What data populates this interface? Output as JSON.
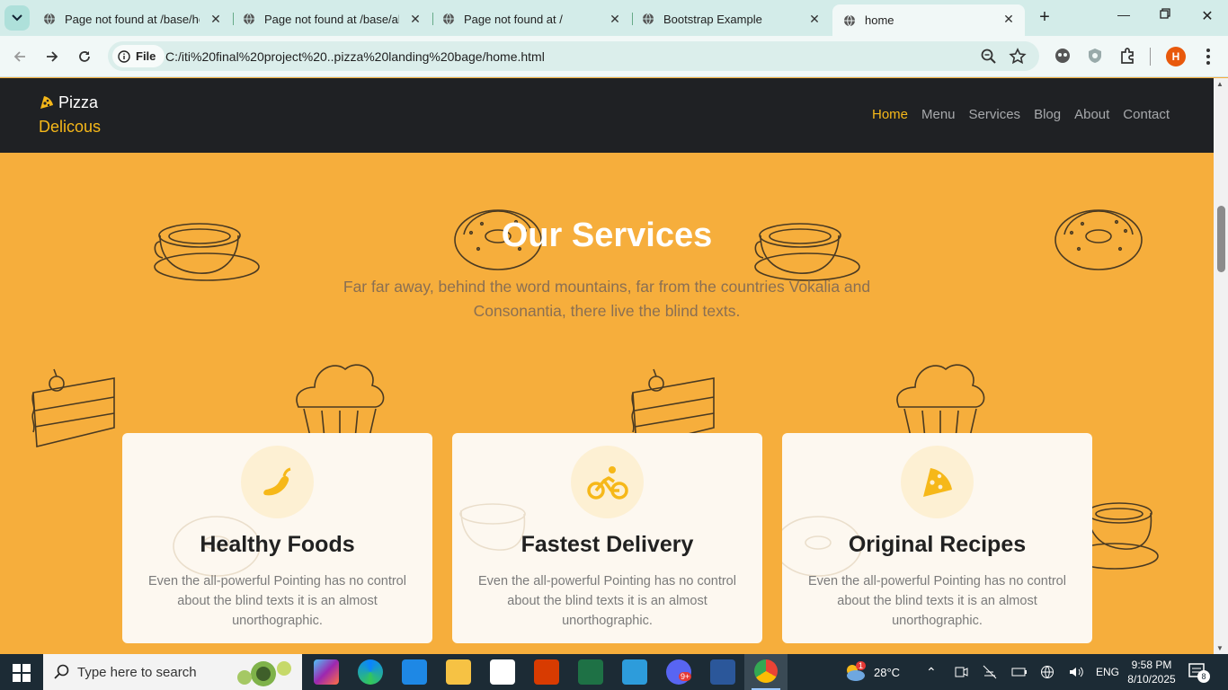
{
  "browser": {
    "tabs": [
      {
        "title": "Page not found at /base/hom",
        "active": false
      },
      {
        "title": "Page not found at /base/abo",
        "active": false
      },
      {
        "title": "Page not found at /",
        "active": false
      },
      {
        "title": "Bootstrap Example",
        "active": false
      },
      {
        "title": "home",
        "active": true
      }
    ],
    "security_chip": "File",
    "url": "C:/iti%20final%20project%20..pizza%20landing%20bage/home.html",
    "profile_initial": "H"
  },
  "site": {
    "brand_line1": "Pizza",
    "brand_line2": "Delicous",
    "nav": [
      "Home",
      "Menu",
      "Services",
      "Blog",
      "About",
      "Contact"
    ],
    "nav_active": "Home",
    "services": {
      "title": "Our Services",
      "subtitle": "Far far away, behind the word mountains, far from the countries Vokalia and Consonantia, there live the blind texts.",
      "cards": [
        {
          "icon": "chili-pepper-icon",
          "title": "Healthy Foods",
          "text": "Even the all-powerful Pointing has no control about the blind texts it is an almost unorthographic."
        },
        {
          "icon": "bicycle-rider-icon",
          "title": "Fastest Delivery",
          "text": "Even the all-powerful Pointing has no control about the blind texts it is an almost unorthographic."
        },
        {
          "icon": "pizza-slice-icon",
          "title": "Original Recipes",
          "text": "Even the all-powerful Pointing has no control about the blind texts it is an almost unorthographic."
        }
      ]
    },
    "colors": {
      "accent": "#f6b819",
      "background": "#f6ae3c",
      "navbar": "#1f2124"
    }
  },
  "taskbar": {
    "search_placeholder": "Type here to search",
    "weather": "28°C",
    "weather_badge": "1",
    "language": "ENG",
    "time": "9:58 PM",
    "date": "8/10/2025",
    "notifications": "8",
    "discord_badge": "9+"
  }
}
